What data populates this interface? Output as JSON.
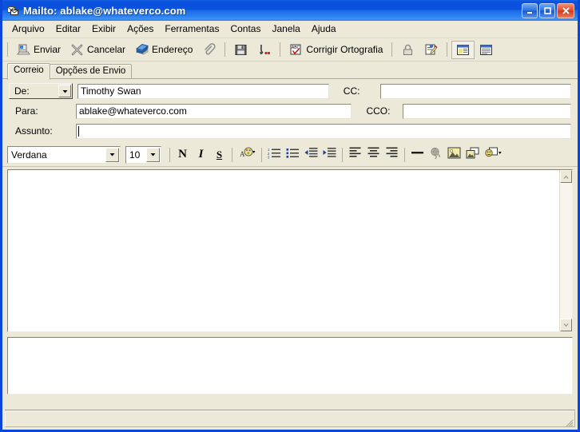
{
  "window": {
    "title": "Mailto: ablake@whateverco.com",
    "icon": "envelope-window-icon",
    "minimize_label": "Minimizar",
    "maximize_label": "Maximizar",
    "close_label": "Fechar"
  },
  "menubar": {
    "items": [
      {
        "label": "Arquivo",
        "name": "menu-arquivo"
      },
      {
        "label": "Editar",
        "name": "menu-editar"
      },
      {
        "label": "Exibir",
        "name": "menu-exibir"
      },
      {
        "label": "Ações",
        "name": "menu-acoes"
      },
      {
        "label": "Ferramentas",
        "name": "menu-ferramentas"
      },
      {
        "label": "Contas",
        "name": "menu-contas"
      },
      {
        "label": "Janela",
        "name": "menu-janela"
      },
      {
        "label": "Ajuda",
        "name": "menu-ajuda"
      }
    ]
  },
  "toolbar": {
    "send_label": "Enviar",
    "cancel_label": "Cancelar",
    "address_label": "Endereço",
    "attach_label": "",
    "save_label": "",
    "send_later_label": "",
    "spell_label": "Corrigir Ortografia",
    "encrypt_label": "",
    "sign_label": "",
    "view1_label": "",
    "view2_label": ""
  },
  "tabs": [
    {
      "label": "Correio",
      "name": "tab-correio",
      "active": true
    },
    {
      "label": "Opções de Envio",
      "name": "tab-opcoes-de-envio",
      "active": false
    }
  ],
  "headers": {
    "from_label": "De:",
    "from_value": "Timothy Swan",
    "to_label": "Para:",
    "to_value": "ablake@whateverco.com",
    "subject_label": "Assunto:",
    "subject_value": "",
    "cc_label": "CC:",
    "cc_value": "",
    "bcc_label": "CCO:",
    "bcc_value": ""
  },
  "format_toolbar": {
    "font_family": "Verdana",
    "font_size": "10",
    "bold_label": "N",
    "italic_label": "I",
    "underline_label": "S",
    "font_color_label": "",
    "numbered_list_label": "",
    "bulleted_list_label": "",
    "decrease_indent_label": "",
    "increase_indent_label": "",
    "align_left_label": "",
    "align_center_label": "",
    "align_right_label": "",
    "horizontal_rule_label": "",
    "hyperlink_label": "",
    "insert_image_label": "",
    "background_image_label": "",
    "emoticon_label": ""
  },
  "body": {
    "message_text": "",
    "attachments_text": ""
  },
  "statusbar": {
    "text": ""
  },
  "colors": {
    "title_active": "#0a52dd",
    "face": "#ece9d8",
    "frame_border": "#0a46d8",
    "field_bg": "#ffffff",
    "close_button": "#e04d2d"
  }
}
